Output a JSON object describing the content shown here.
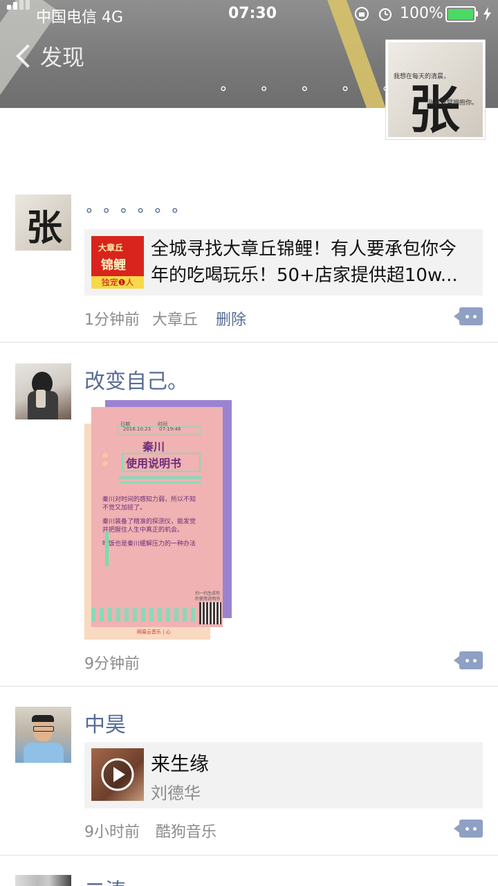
{
  "status": {
    "carrier": "中国电信",
    "network": "4G",
    "time": "07:30",
    "battery": "100%"
  },
  "header": {
    "back_label": "发现",
    "loading_dots": "∘ ∘ ∘ ∘ ∘ ∘"
  },
  "cover_avatar": {
    "char": "张",
    "line1": "我想在每天的清晨，",
    "line2": "张开双臂拥抱你。"
  },
  "posts": [
    {
      "name": "∘ ∘ ∘ ∘ ∘ ∘",
      "avatar_char": "张",
      "link": {
        "title": "全城寻找大章丘锦鲤！有人要承包你今年的吃喝玩乐！50+店家提供超10w...",
        "thumb_top": "大章丘",
        "thumb_mid": "锦鲤",
        "thumb_bottom": "独宠❶人"
      },
      "time": "1分钟前",
      "location": "大章丘",
      "delete_label": "删除"
    },
    {
      "name": "改变自己。",
      "poster": {
        "date_label": "日期",
        "time_label": "时间",
        "date": "2018.10.23",
        "time": "07:19:46",
        "title1": "秦川",
        "title2": "使用说明书",
        "line1": "秦川对时间的感知力弱，所以不知",
        "line2": "不觉又加班了。",
        "line3": "秦川装备了精准的探测仪，能发觉",
        "line4": "并把握住人生中真正的机会。",
        "line5": "吃饭也是秦川缓解压力的一种办法",
        "qr1": "扫一扫生成你",
        "qr2": "的使用说明书",
        "footer": "网易云音乐 | 心"
      },
      "time": "9分钟前"
    },
    {
      "name": "中昊",
      "music": {
        "title": "来生缘",
        "artist": "刘德华"
      },
      "time": "9小时前",
      "source": "酷狗音乐"
    },
    {
      "name": "二涛"
    }
  ],
  "colors": {
    "link_blue": "#576b95",
    "meta_gray": "#8c8c8c",
    "battery_green": "#4cd964"
  }
}
